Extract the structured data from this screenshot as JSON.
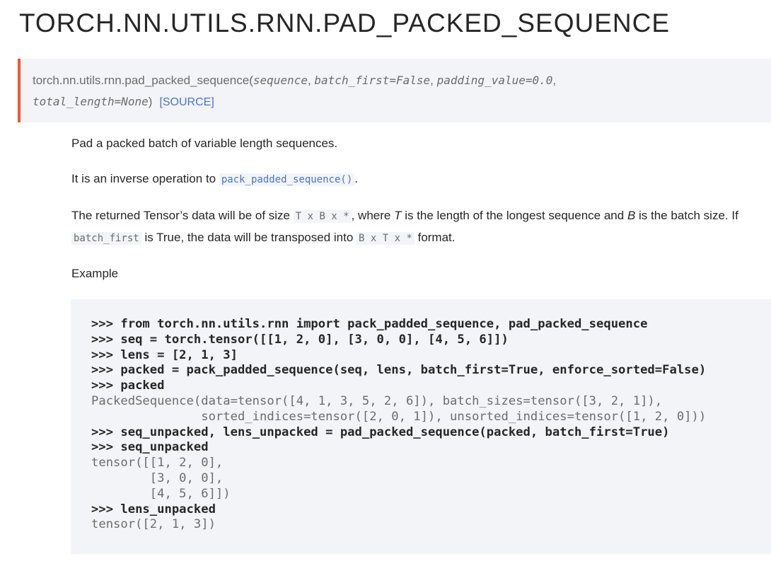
{
  "title": "TORCH.NN.UTILS.RNN.PAD_PACKED_SEQUENCE",
  "signature": {
    "name": "torch.nn.utils.rnn.pad_packed_sequence",
    "open_paren": "(",
    "params": [
      "sequence",
      "batch_first=False",
      "padding_value=0.0",
      "total_length=None"
    ],
    "close_paren": ")",
    "source_link": "[SOURCE]",
    "accent_color": "#f05732"
  },
  "description": {
    "p1": "Pad a packed batch of variable length sequences.",
    "p2_prefix": "It is an inverse operation to ",
    "p2_link": "pack_padded_sequence()",
    "p2_suffix": ".",
    "p3_a": "The returned Tensor’s data will be of size ",
    "p3_code1": "T x B x *",
    "p3_b": ", where ",
    "p3_T": "T",
    "p3_c": " is the length of the longest sequence and ",
    "p3_B": "B",
    "p3_d": " is the batch size. If ",
    "p3_code2": "batch_first",
    "p3_e": " is True, the data will be transposed into ",
    "p3_code3": "B x T x *",
    "p3_f": " format.",
    "example_label": "Example"
  },
  "code_example": {
    "lines": [
      {
        "kind": "input",
        "text": ">>> from torch.nn.utils.rnn import pack_padded_sequence, pad_packed_sequence"
      },
      {
        "kind": "input",
        "text": ">>> seq = torch.tensor([[1, 2, 0], [3, 0, 0], [4, 5, 6]])"
      },
      {
        "kind": "input",
        "text": ">>> lens = [2, 1, 3]"
      },
      {
        "kind": "input",
        "text": ">>> packed = pack_padded_sequence(seq, lens, batch_first=True, enforce_sorted=False)"
      },
      {
        "kind": "input",
        "text": ">>> packed"
      },
      {
        "kind": "output",
        "text": "PackedSequence(data=tensor([4, 1, 3, 5, 2, 6]), batch_sizes=tensor([3, 2, 1]),"
      },
      {
        "kind": "output",
        "text": "               sorted_indices=tensor([2, 0, 1]), unsorted_indices=tensor([1, 2, 0]))"
      },
      {
        "kind": "input",
        "text": ">>> seq_unpacked, lens_unpacked = pad_packed_sequence(packed, batch_first=True)"
      },
      {
        "kind": "input",
        "text": ">>> seq_unpacked"
      },
      {
        "kind": "output",
        "text": "tensor([[1, 2, 0],"
      },
      {
        "kind": "output",
        "text": "        [3, 0, 0],"
      },
      {
        "kind": "output",
        "text": "        [4, 5, 6]])"
      },
      {
        "kind": "input",
        "text": ">>> lens_unpacked"
      },
      {
        "kind": "output",
        "text": "tensor([2, 1, 3])"
      }
    ]
  }
}
